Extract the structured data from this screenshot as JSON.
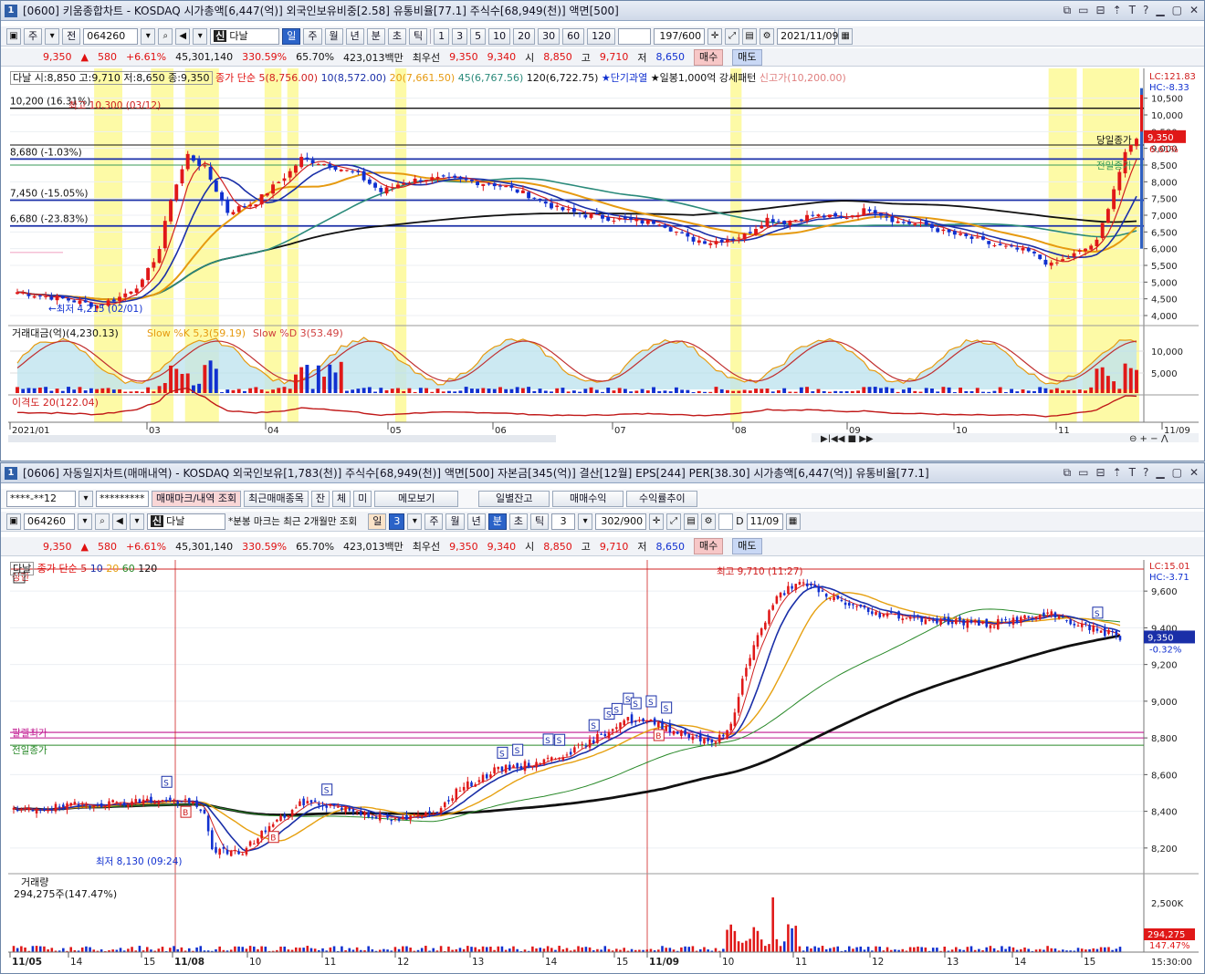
{
  "top": {
    "title": "[0600] 키움종합차트 - KOSDAQ 시가총액[6,447(억)] 외국인보유비중[2.58] 유통비율[77.1] 주식수[68,949(천)] 액면[500]",
    "win_num": "1",
    "toolbar": {
      "period_btn": "주",
      "prev_btn": "전",
      "code": "064260",
      "name": "다날",
      "tabs": [
        "일",
        "주",
        "월",
        "년",
        "분",
        "초",
        "틱"
      ],
      "selected_tab": "일",
      "nums": [
        "1",
        "3",
        "5",
        "10",
        "20",
        "30",
        "60",
        "120"
      ],
      "count": "197/600",
      "date": "2021/11/09"
    },
    "quote": {
      "price": "9,350",
      "change": "580",
      "pct": "+6.61%",
      "volume": "45,301,140",
      "ratio": "330.59%",
      "ratio2": "65.70%",
      "amount": "423,013백만",
      "pref_label": "최우선",
      "pref_sell": "9,350",
      "pref_buy": "9,340",
      "open_label": "시",
      "open": "8,850",
      "high_label": "고",
      "high": "9,710",
      "low_label": "저",
      "low": "8,650",
      "buy": "매수",
      "sell": "매도"
    },
    "legend": {
      "head": "다날 시:8,850 고:9,710 저:8,650 종:9,350",
      "ma_label": "종가 단순",
      "ma5": "5(8,756.00)",
      "ma10": "10(8,572.00)",
      "ma20": "20(7,661.50)",
      "ma45": "45(6,767.56)",
      "ma120": "120(6,722.75)",
      "short_over": "★단기과열",
      "daily_pattern": "★일봉1,000억 강세패턴",
      "new_high": "신고가(10,200.00)"
    },
    "hlines": [
      "10,200 (16.31%)",
      "8,680 (-1.03%)",
      "7,450 (-15.05%)",
      "6,680 (-23.83%)"
    ],
    "annot": {
      "high": "최고 10,300 (03/12)",
      "low": "←최저 4,215 (02/01)",
      "today_close": "당일종가",
      "prev_close": "전일종가"
    },
    "price_axis": {
      "lc": "LC:121.83",
      "hc": "HC:-8.33",
      "current": "9,350",
      "current_pct": "6.61%",
      "ticks": [
        "10,500",
        "10,000",
        "9,500",
        "9,000",
        "8,500",
        "8,000",
        "7,500",
        "7,000",
        "6,500",
        "6,000",
        "5,500",
        "5,000",
        "4,500",
        "4,000"
      ]
    },
    "sub1": {
      "label1": "거래대금(억)(4,230.13)",
      "label2": "Slow %K 5,3(59.19)",
      "label3": "Slow %D 3(53.49)",
      "ticks": [
        "10,000",
        "5,000"
      ]
    },
    "sub2": {
      "label": "이격도 20(122.04)"
    },
    "x_axis": [
      "2021/01",
      "03",
      "04",
      "05",
      "06",
      "07",
      "08",
      "09",
      "10",
      "11",
      "11/09"
    ],
    "bottom_tools": "⊖ + − ⋀"
  },
  "bottom": {
    "title": "[0606] 자동일지차트(매매내역) - KOSDAQ 외국인보유[1,783(천)] 주식수[68,949(천)] 액면[500] 자본금[345(억)] 결산[12월] EPS[244] PER[38.30] 시가총액[6,447(억)] 유통비율[77.1]",
    "win_num": "1",
    "row1": {
      "account": "****-**12",
      "password": "*********",
      "btn_marks": "매매마크/내역 조회",
      "btn_recent": "최근매매종목",
      "jan": "잔",
      "che": "체",
      "mi": "미",
      "memo": "메모보기",
      "daily_bal": "일별잔고",
      "profit": "매매수익",
      "profit_trend": "수익률추이"
    },
    "row2": {
      "code": "064260",
      "name": "다날",
      "note": "*분봉 마크는 최근 2개월만 조회",
      "tabs": [
        "일",
        "3",
        "주",
        "월",
        "년",
        "분",
        "초",
        "틱"
      ],
      "selected_tab": "분",
      "min": "3",
      "count": "302/900",
      "date_chk": "D",
      "date": "11/09"
    },
    "quote": {
      "price": "9,350",
      "change": "580",
      "pct": "+6.61%",
      "volume": "45,301,140",
      "ratio": "330.59%",
      "ratio2": "65.70%",
      "amount": "423,013백만",
      "pref_label": "최우선",
      "pref_sell": "9,350",
      "pref_buy": "9,340",
      "open_label": "시",
      "open": "8,850",
      "high_label": "고",
      "high": "9,710",
      "low_label": "저",
      "low": "8,650",
      "buy": "매수",
      "sell": "매도"
    },
    "legend": {
      "name": "다날",
      "ma_label": "종가 단순",
      "m5": "5",
      "m10": "10",
      "m20": "20",
      "m60": "60",
      "m120": "120",
      "sangdong": "상한"
    },
    "annot": {
      "high": "최고 9,710 (11:27)",
      "low": "최저 8,130 (09:24)",
      "pivot": "팔렐최가",
      "prev_close": "전일종가"
    },
    "price_axis": {
      "lc": "LC:15.01",
      "hc": "HC:-3.71",
      "current": "9,350",
      "current_pct": "-0.32%",
      "ticks": [
        "9,600",
        "9,400",
        "9,200",
        "9,000",
        "8,800",
        "8,600",
        "8,400",
        "8,200"
      ]
    },
    "vol": {
      "label": "거래량",
      "value": "294,275주(147.47%)",
      "tick": "2,500K",
      "current": "294,275",
      "pct": "147.47%"
    },
    "x_axis": [
      "11/05",
      "14",
      "15",
      "11/08",
      "10",
      "11",
      "12",
      "13",
      "14",
      "15",
      "11/09",
      "10",
      "11",
      "12",
      "13",
      "14",
      "15"
    ],
    "time": "15:30:00"
  }
}
